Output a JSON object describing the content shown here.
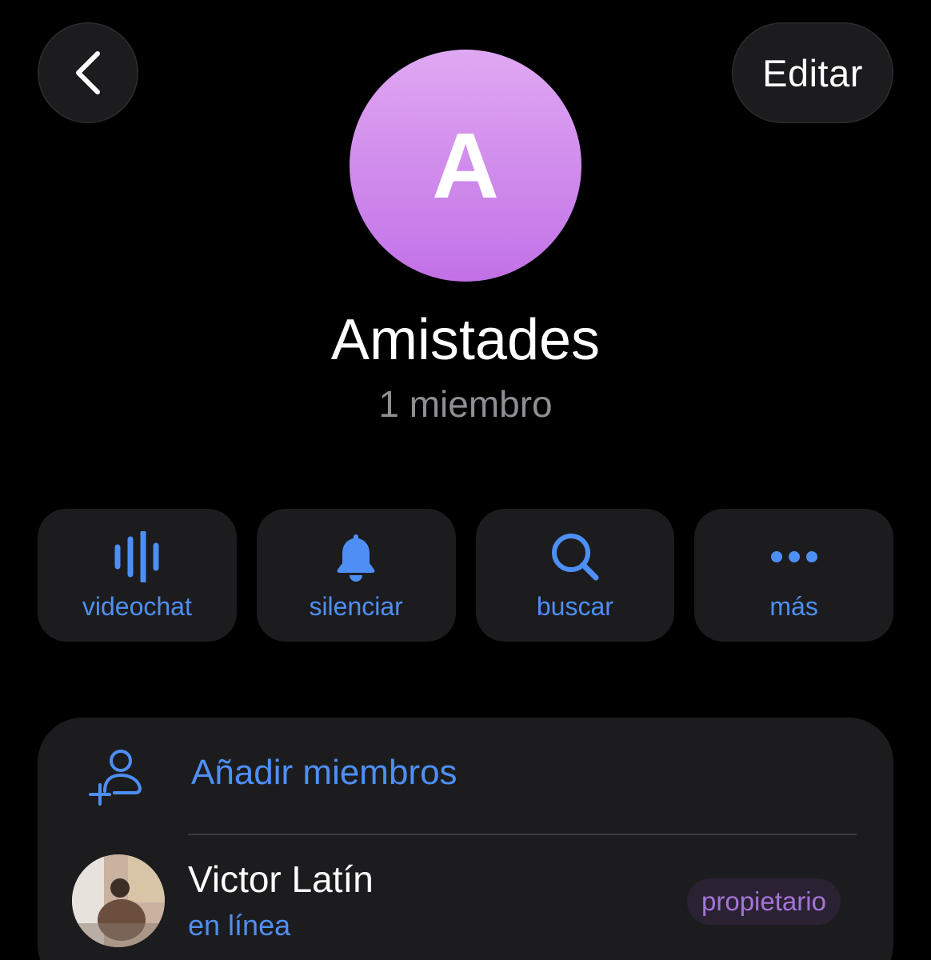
{
  "header": {
    "back_icon": "chevron-left-icon",
    "edit_label": "Editar"
  },
  "group": {
    "avatar_letter": "A",
    "avatar_colors": [
      "#dfa8f2",
      "#c271e6"
    ],
    "title": "Amistades",
    "subtitle": "1 miembro"
  },
  "actions": [
    {
      "label": "videochat",
      "icon": "voice-chat-icon"
    },
    {
      "label": "silenciar",
      "icon": "bell-icon"
    },
    {
      "label": "buscar",
      "icon": "search-icon"
    },
    {
      "label": "más",
      "icon": "more-dots-icon"
    }
  ],
  "members": {
    "add_label": "Añadir miembros",
    "add_icon": "add-person-icon",
    "list": [
      {
        "name": "Victor Latín",
        "status": "en línea",
        "role": "propietario"
      }
    ]
  },
  "colors": {
    "accent": "#4e8ff5",
    "card": "#1c1c1e",
    "badge_text": "#a574d8",
    "secondary_text": "#8e8e93"
  }
}
